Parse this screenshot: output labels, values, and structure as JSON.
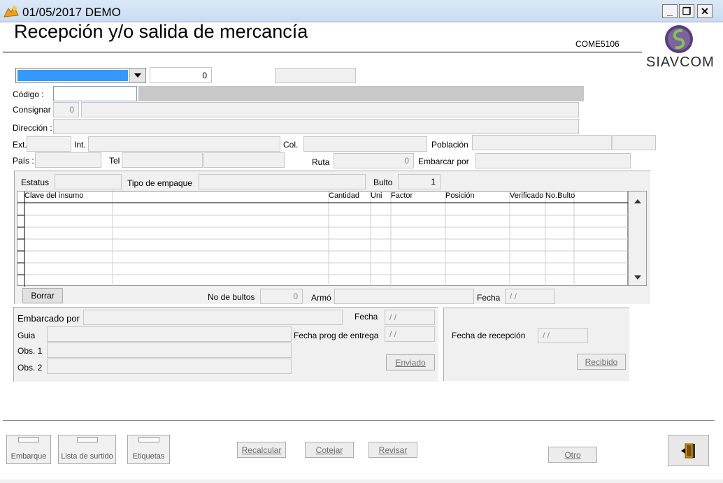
{
  "window": {
    "title": "01/05/2017  DEMO",
    "controls": [
      "_",
      "❐",
      "✕"
    ]
  },
  "header": {
    "title": "Recepción y/o salida de mercancía",
    "code": "COME5106",
    "logo_text": "SIAVCOM"
  },
  "top": {
    "combo_value": "",
    "number_value": "0",
    "right_value": ""
  },
  "customer": {
    "codigo_label": "Código :",
    "consignar_label": "Consignar",
    "consignar_value": "0",
    "direccion_label": "Dirección :",
    "ext_label": "Ext.",
    "int_label": "Int.",
    "col_label": "Col.",
    "poblacion_label": "Población",
    "pais_label": "País :",
    "tel_label": "Tel",
    "ruta_label": "Ruta",
    "ruta_value": "0",
    "embarcar_por_label": "Embarcar por"
  },
  "detail": {
    "estatus_label": "Estatus",
    "tipo_empaque_label": "Tipo de empaque",
    "bulto_label": "Bulto",
    "bulto_value": "1",
    "columns": [
      "Clave del insumo",
      "Cantidad",
      "Uni",
      "Factor",
      "Posición",
      "Verificado",
      "No.Bulto"
    ],
    "borrar_label": "Borrar",
    "no_bultos_label": "No de bultos",
    "no_bultos_value": "0",
    "armo_label": "Armó",
    "fecha_label": "Fecha",
    "fecha_value": "/ /"
  },
  "shipping": {
    "embarcado_por_label": "Embarcado por",
    "fecha_label": "Fecha",
    "fecha_value": "/ /",
    "guia_label": "Guia",
    "fecha_prog_label": "Fecha prog de entrega",
    "fecha_prog_value": "/ /",
    "obs1_label": "Obs. 1",
    "obs2_label": "Obs. 2",
    "enviado_label": "Enviado"
  },
  "reception": {
    "fecha_recepcion_label": "Fecha de recepción",
    "fecha_recepcion_value": "/ /",
    "recibido_label": "Recibido"
  },
  "footer": {
    "embarque_label": "Embarque",
    "lista_surtido_label": "Lista de surtido",
    "etiquetas_label": "Etiquetas",
    "recalcular_label": "Recalcular",
    "cotejar_label": "Cotejar",
    "revisar_label": "Revisar",
    "otro_label": "Otro"
  },
  "colors": {
    "titlebar": "#c9dcf0",
    "combo_selection": "#3399ff",
    "panel": "#f0f0f0"
  }
}
